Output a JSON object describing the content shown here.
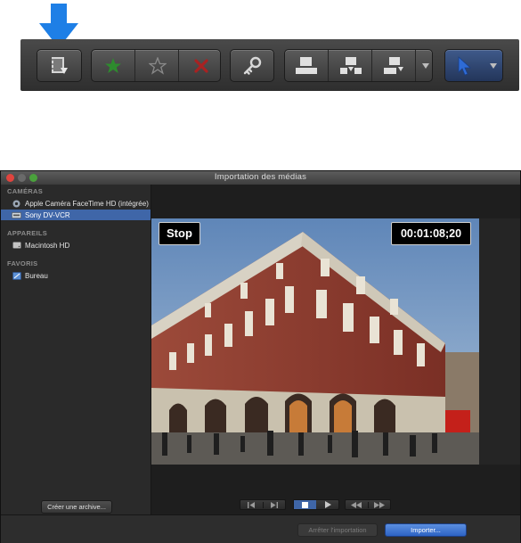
{
  "toolbar": {
    "buttons": [
      {
        "name": "import-media-button",
        "icon": "film-import-icon"
      },
      {
        "name": "favorite-button",
        "icon": "green-star-icon",
        "color": "#2e8b2e"
      },
      {
        "name": "unrate-button",
        "icon": "outline-star-icon"
      },
      {
        "name": "reject-button",
        "icon": "red-x-icon",
        "color": "#a82222"
      },
      {
        "name": "keyword-button",
        "icon": "key-icon"
      },
      {
        "name": "connect-clip-button",
        "icon": "connect-clip-icon"
      },
      {
        "name": "insert-clip-button",
        "icon": "insert-clip-icon"
      },
      {
        "name": "append-clip-button",
        "icon": "append-clip-icon"
      },
      {
        "name": "edit-menu-button",
        "icon": "chevron-down-icon"
      },
      {
        "name": "select-tool-button",
        "icon": "arrow-pointer-icon",
        "color": "#2e6bd6"
      }
    ],
    "highlight_arrow_color": "#1e7fe6"
  },
  "window": {
    "title": "Importation des médias",
    "sidebar": {
      "sections": [
        {
          "heading": "CAMÉRAS",
          "items": [
            {
              "label": "Apple Caméra FaceTime HD (intégrée)",
              "icon": "camera-icon",
              "selected": false
            },
            {
              "label": "Sony DV-VCR",
              "icon": "tape-deck-icon",
              "selected": true
            }
          ]
        },
        {
          "heading": "APPAREILS",
          "items": [
            {
              "label": "Macintosh HD",
              "icon": "hard-drive-icon",
              "selected": false
            }
          ]
        },
        {
          "heading": "FAVORIS",
          "items": [
            {
              "label": "Bureau",
              "icon": "desktop-folder-icon",
              "selected": false
            }
          ]
        }
      ],
      "archive_button": "Créer une archive..."
    },
    "viewer": {
      "status": "Stop",
      "timecode": "00:01:08;20"
    },
    "footer": {
      "stop_import": "Arrêter l'importation",
      "import": "Importer..."
    },
    "accent": "#3f66a8"
  }
}
